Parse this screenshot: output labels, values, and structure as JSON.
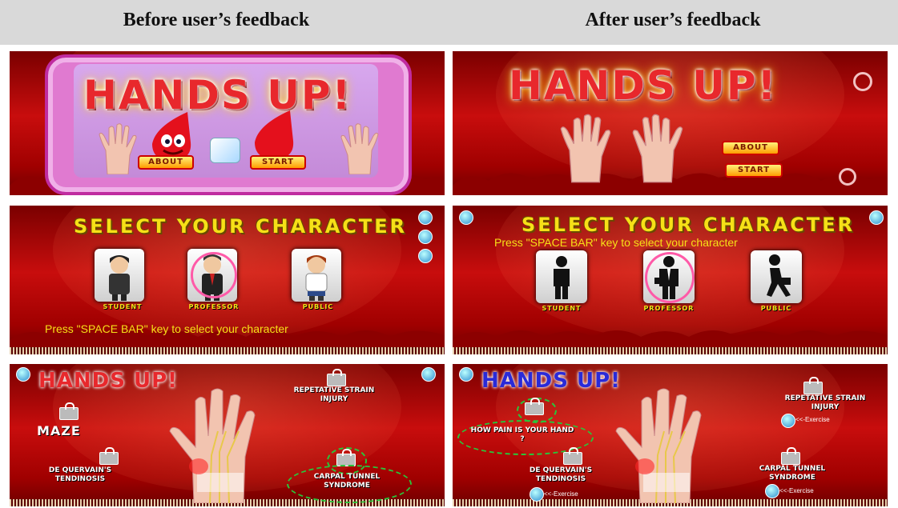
{
  "headers": {
    "before": "Before user’s feedback",
    "after": "After user’s feedback"
  },
  "screens": {
    "title": {
      "game_title": "HANDS UP!",
      "about_label": "ABOUT",
      "start_label": "START"
    },
    "select": {
      "heading": "SELECT YOUR CHARACTER",
      "instruction": "Press \"SPACE BAR\" key to select your character",
      "characters": [
        "STUDENT",
        "PROFESSOR",
        "PUBLIC"
      ]
    },
    "menu": {
      "game_title": "HANDS UP!",
      "maze_label": "MAZE",
      "rsi_label": "REPETATIVE STRAIN INJURY",
      "dqt_label": "DE QUERVAIN'S TENDINOSIS",
      "cts_label": "CARPAL TUNNEL SYNDROME",
      "pain_label": "HOW PAIN IS YOUR HAND ?",
      "exercise_label": "<<-Exercise"
    }
  },
  "colors": {
    "background_red": "#c80d0d",
    "title_yellow": "#f6e017",
    "highlight_pink": "#ff5aa8",
    "dashed_green": "#2ac43a"
  }
}
